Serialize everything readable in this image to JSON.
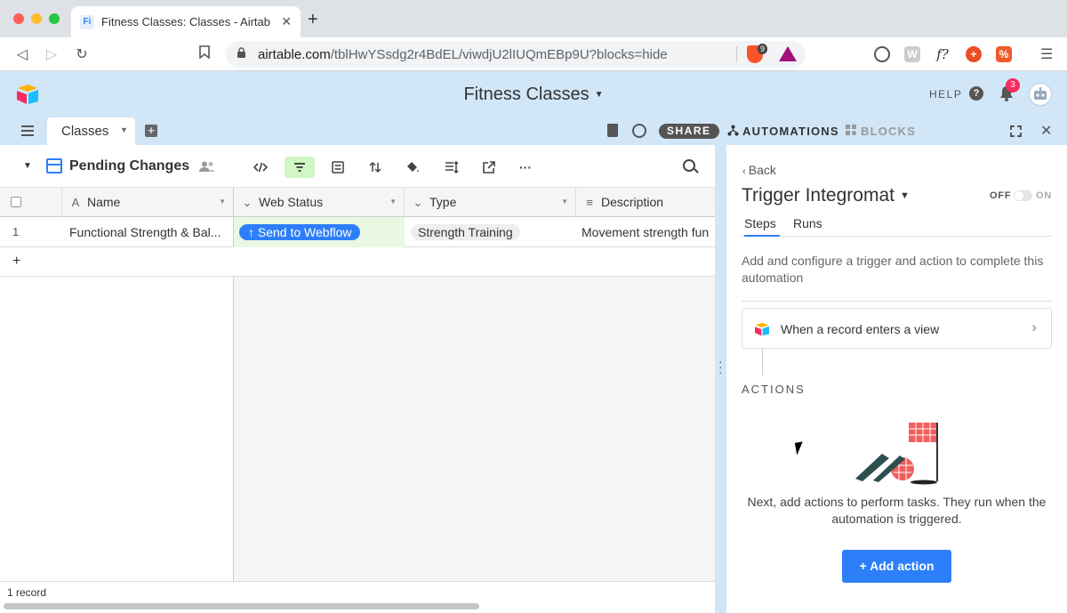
{
  "browser": {
    "tab_favicon": "Fi",
    "tab_title": "Fitness Classes: Classes - Airtab",
    "url_host": "airtable.com",
    "url_path": "/tblHwYSsdg2r4BdEL/viwdjU2lIUQmEBp9U?blocks=hide",
    "brave_badge": "9"
  },
  "header": {
    "base_name": "Fitness Classes",
    "help_label": "HELP",
    "notification_count": "3"
  },
  "tabs": {
    "table_name": "Classes",
    "share_label": "SHARE",
    "automations_label": "AUTOMATIONS",
    "blocks_label": "BLOCKS"
  },
  "view": {
    "name": "Pending Changes"
  },
  "grid": {
    "columns": [
      {
        "label": "Name",
        "icon": "text-icon"
      },
      {
        "label": "Web Status",
        "icon": "single-select-icon"
      },
      {
        "label": "Type",
        "icon": "single-select-icon"
      },
      {
        "label": "Description",
        "icon": "long-text-icon"
      }
    ],
    "rows": [
      {
        "num": "1",
        "name": "Functional Strength & Bal...",
        "web_status": "↑ Send to Webflow",
        "type": "Strength Training",
        "description": "Movement strength fun"
      }
    ],
    "add_row": "+",
    "record_count": "1 record"
  },
  "panel": {
    "back_label": "Back",
    "title": "Trigger Integromat",
    "toggle_off": "OFF",
    "toggle_on": "ON",
    "tabs": [
      "Steps",
      "Runs"
    ],
    "description": "Add and configure a trigger and action to complete this automation",
    "trigger_label": "When a record enters a view",
    "actions_heading": "ACTIONS",
    "empty_text": "Next, add actions to perform tasks. They run when the automation is triggered.",
    "add_action_label": "+ Add action"
  },
  "colors": {
    "accent": "#2d7ff9",
    "header_bg": "#d1e6f7",
    "filter_active": "#d1f7c4"
  }
}
